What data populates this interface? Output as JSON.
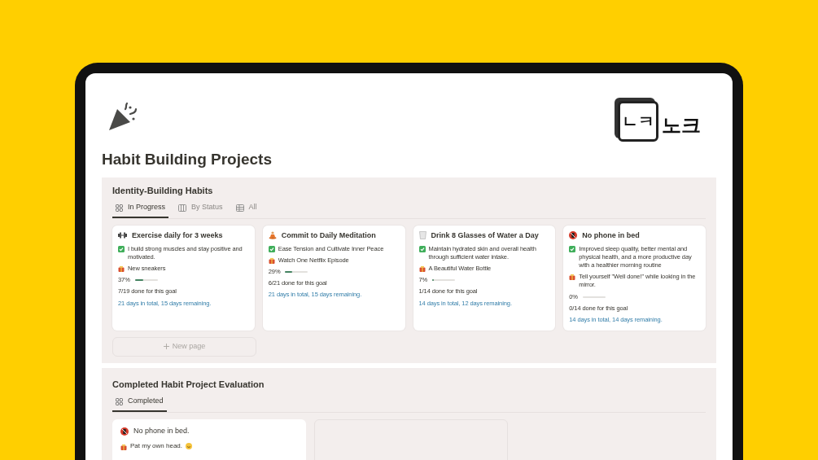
{
  "logo": {
    "cube_text": "ㄴㅋ",
    "text": "노크"
  },
  "page_title": "Habit Building Projects",
  "in_progress": {
    "title": "Identity-Building Habits",
    "tabs": [
      {
        "label": "In Progress",
        "selected": true
      },
      {
        "label": "By Status",
        "selected": false
      },
      {
        "label": "All",
        "selected": false
      }
    ],
    "cards": [
      {
        "title": "Exercise daily for 3 weeks",
        "benefit": "I build strong muscles and stay positive and motivated.",
        "reward": "New sneakers",
        "percent": "37%",
        "level": 0.37,
        "done": "7/19 done for this goal",
        "days": "21 days in total, 15 days remaining."
      },
      {
        "title": "Commit to Daily Meditation",
        "benefit": "Ease Tension and Cultivate Inner Peace",
        "reward": "Watch One Netflix Episode",
        "percent": "29%",
        "level": 0.29,
        "done": "6/21 done for this goal",
        "days": "21 days in total, 15 days remaining."
      },
      {
        "title": "Drink 8 Glasses of Water a Day",
        "benefit": "Maintain hydrated skin and overall health through sufficient water intake.",
        "reward": "A Beautiful Water Bottle",
        "percent": "7%",
        "level": 0.07,
        "done": "1/14 done for this goal",
        "days": "14 days in total, 12 days remaining."
      },
      {
        "title": "No phone in bed",
        "benefit": "Improved sleep quality, better mental and physical health, and a more productive day with a healthier morning routine",
        "reward": "Tell yourself \"Well done!\" while looking in the mirror.",
        "percent": "0%",
        "level": 0,
        "done": "0/14 done for this goal",
        "days": "14 days in total, 14 days remaining."
      }
    ],
    "new_page": "New page"
  },
  "completed": {
    "title": "Completed Habit Project Evaluation",
    "tabs": [
      {
        "label": "Completed",
        "selected": true
      }
    ],
    "cards": [
      {
        "title": "No phone in bed.",
        "reward": "Pat my own head."
      }
    ]
  }
}
